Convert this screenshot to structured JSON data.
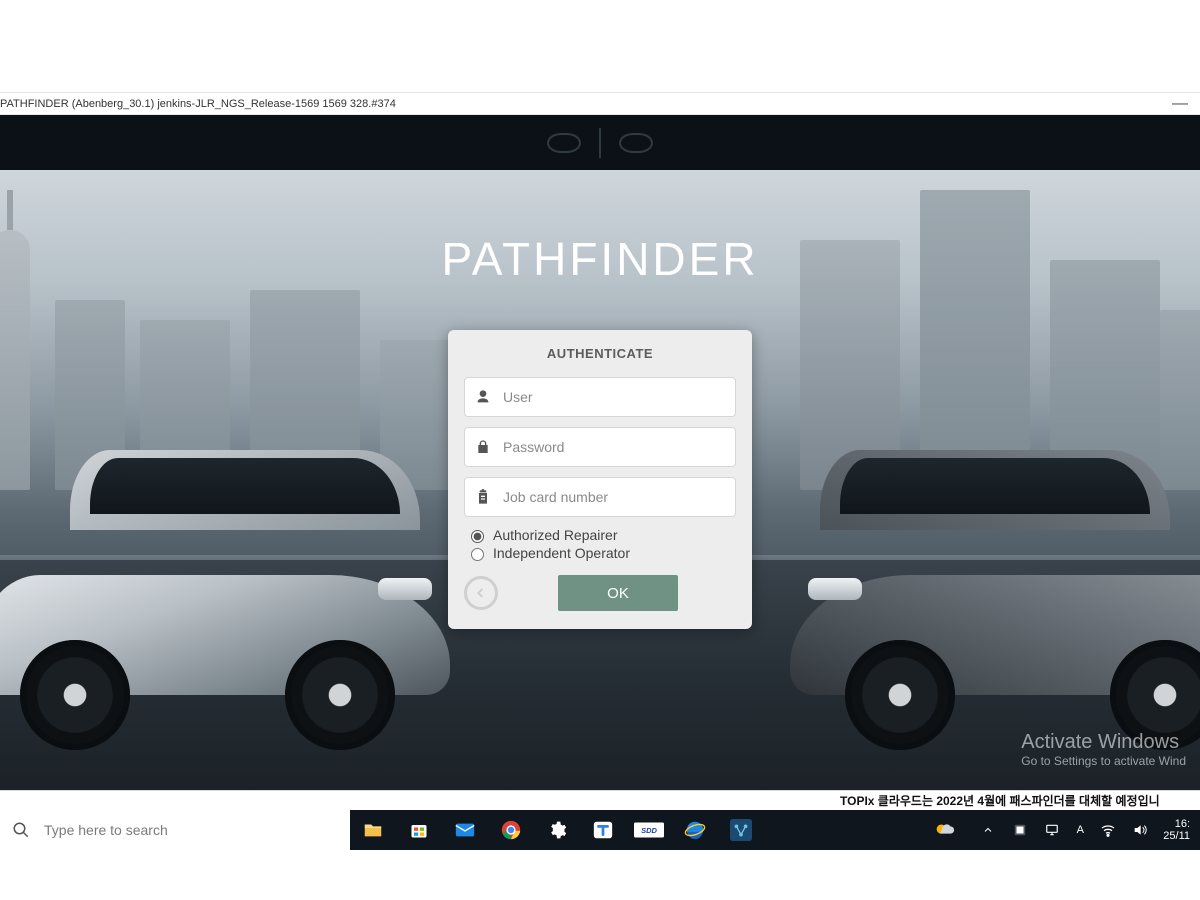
{
  "window": {
    "title": "PATHFINDER (Abenberg_30.1) jenkins-JLR_NGS_Release-1569 1569 328.#374",
    "minimize": "—"
  },
  "hero": {
    "title": "PATHFINDER"
  },
  "auth": {
    "heading": "AUTHENTICATE",
    "user_placeholder": "User",
    "password_placeholder": "Password",
    "jobcard_placeholder": "Job card number",
    "role_authorized": "Authorized Repairer",
    "role_independent": "Independent Operator",
    "ok_label": "OK"
  },
  "watermark": {
    "line1": "Activate Windows",
    "line2": "Go to Settings to activate Wind"
  },
  "crop": {
    "right": "TOPIx 클라우드는 2022년 4월에 패스파인더를 대체할 예정입니"
  },
  "taskbar": {
    "search_placeholder": "Type here to search",
    "clock_time": "16:",
    "clock_date": "25/11"
  }
}
